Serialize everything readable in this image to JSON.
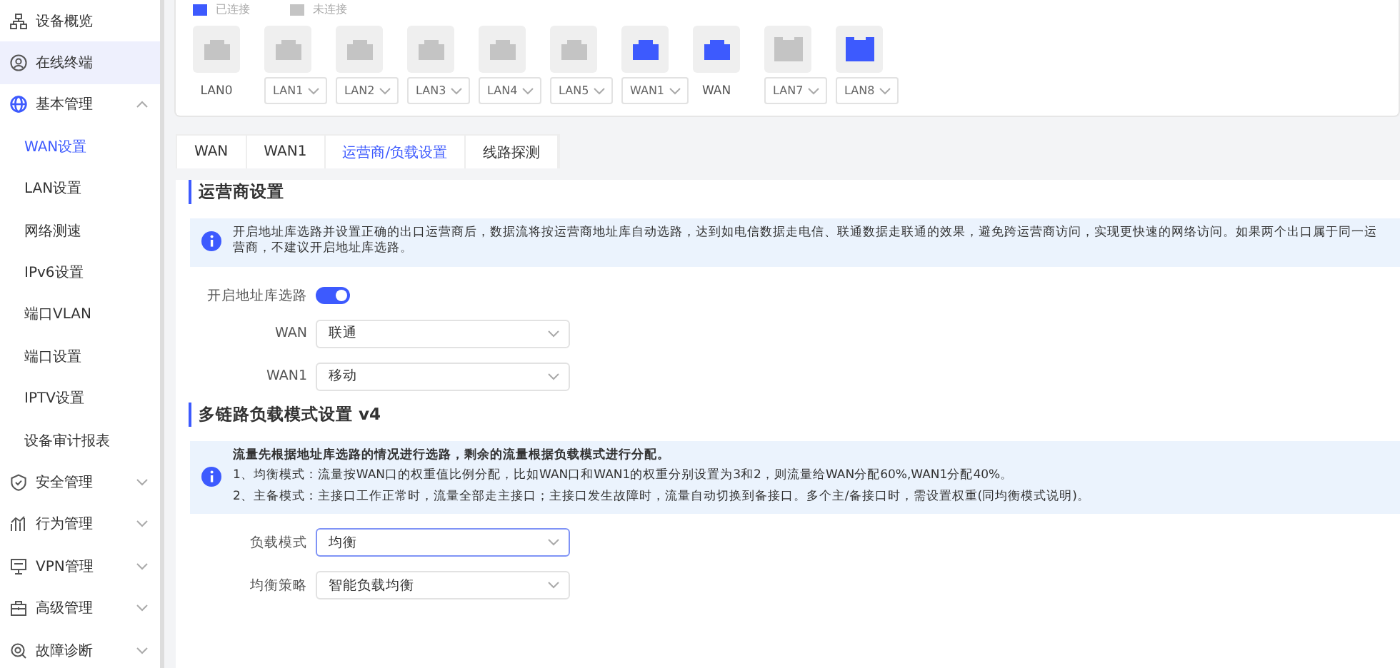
{
  "sidebar": {
    "items": [
      {
        "label": "设备概览",
        "selected": false
      },
      {
        "label": "在线终端",
        "selected": true
      },
      {
        "label": "基本管理",
        "selected": false,
        "expanded": true,
        "children": [
          {
            "label": "WAN设置",
            "selected": true
          },
          {
            "label": "LAN设置",
            "selected": false
          },
          {
            "label": "网络测速",
            "selected": false
          },
          {
            "label": "IPv6设置",
            "selected": false
          },
          {
            "label": "端口VLAN",
            "selected": false
          },
          {
            "label": "端口设置",
            "selected": false
          },
          {
            "label": "IPTV设置",
            "selected": false
          },
          {
            "label": "设备审计报表",
            "selected": false
          }
        ]
      },
      {
        "label": "安全管理",
        "selected": false,
        "expanded": false
      },
      {
        "label": "行为管理",
        "selected": false,
        "expanded": false
      },
      {
        "label": "VPN管理",
        "selected": false,
        "expanded": false
      },
      {
        "label": "高级管理",
        "selected": false,
        "expanded": false
      },
      {
        "label": "故障诊断",
        "selected": false,
        "expanded": false
      }
    ]
  },
  "ports": {
    "legend": [
      {
        "label": "已连接",
        "color": "#3d5afe"
      },
      {
        "label": "未连接",
        "color": "#c4c4c4"
      }
    ],
    "items": [
      {
        "name": "LAN0",
        "kind": "label",
        "connected": false,
        "sfp": false
      },
      {
        "name": "LAN1",
        "kind": "select",
        "connected": false,
        "sfp": false
      },
      {
        "name": "LAN2",
        "kind": "select",
        "connected": false,
        "sfp": false
      },
      {
        "name": "LAN3",
        "kind": "select",
        "connected": false,
        "sfp": false
      },
      {
        "name": "LAN4",
        "kind": "select",
        "connected": false,
        "sfp": false
      },
      {
        "name": "LAN5",
        "kind": "select",
        "connected": false,
        "sfp": false
      },
      {
        "name": "WAN1",
        "kind": "select",
        "connected": true,
        "sfp": false
      },
      {
        "name": "WAN",
        "kind": "label",
        "connected": true,
        "sfp": false
      },
      {
        "name": "LAN7",
        "kind": "select",
        "connected": false,
        "sfp": true
      },
      {
        "name": "LAN8",
        "kind": "select",
        "connected": true,
        "sfp": true
      }
    ]
  },
  "tabs": [
    {
      "label": "WAN",
      "selected": false
    },
    {
      "label": "WAN1",
      "selected": false
    },
    {
      "label": "运营商/负载设置",
      "selected": true
    },
    {
      "label": "线路探测",
      "selected": false
    }
  ],
  "sections": [
    {
      "title": "运营商设置",
      "info": {
        "lines": [
          "开启地址库选路并设置正确的出口运营商后，数据流将按运营商地址库自动选路，达到如电信数据走电信、联通数据走联通的效果，避免跨运营商访问，实现更快速的网络访问。如果两个出口属于同一运营商，不建议开启地址库选路。"
        ]
      },
      "fields": [
        {
          "kind": "toggle",
          "label": "开启地址库选路",
          "on": true
        },
        {
          "kind": "select",
          "label": "WAN",
          "value": "联通",
          "focused": false
        },
        {
          "kind": "select",
          "label": "WAN1",
          "value": "移动",
          "focused": false
        }
      ]
    },
    {
      "title": "多链路负载模式设置 v4",
      "info": {
        "lines": [
          "**流量先根据地址库选路的情况进行选路，剩余的流量根据负载模式进行分配。**",
          "1、均衡模式：流量按WAN口的权重值比例分配，比如WAN口和WAN1的权重分别设置为3和2，则流量给WAN分配60%,WAN1分配40%。",
          "2、主备模式：主接口工作正常时，流量全部走主接口；主接口发生故障时，流量自动切换到备接口。多个主/备接口时，需设置权重(同均衡模式说明)。"
        ]
      },
      "fields": [
        {
          "kind": "select",
          "label": "负载模式",
          "value": "均衡",
          "focused": true
        },
        {
          "kind": "select",
          "label": "均衡策略",
          "value": "智能负载均衡",
          "focused": false
        }
      ]
    }
  ]
}
